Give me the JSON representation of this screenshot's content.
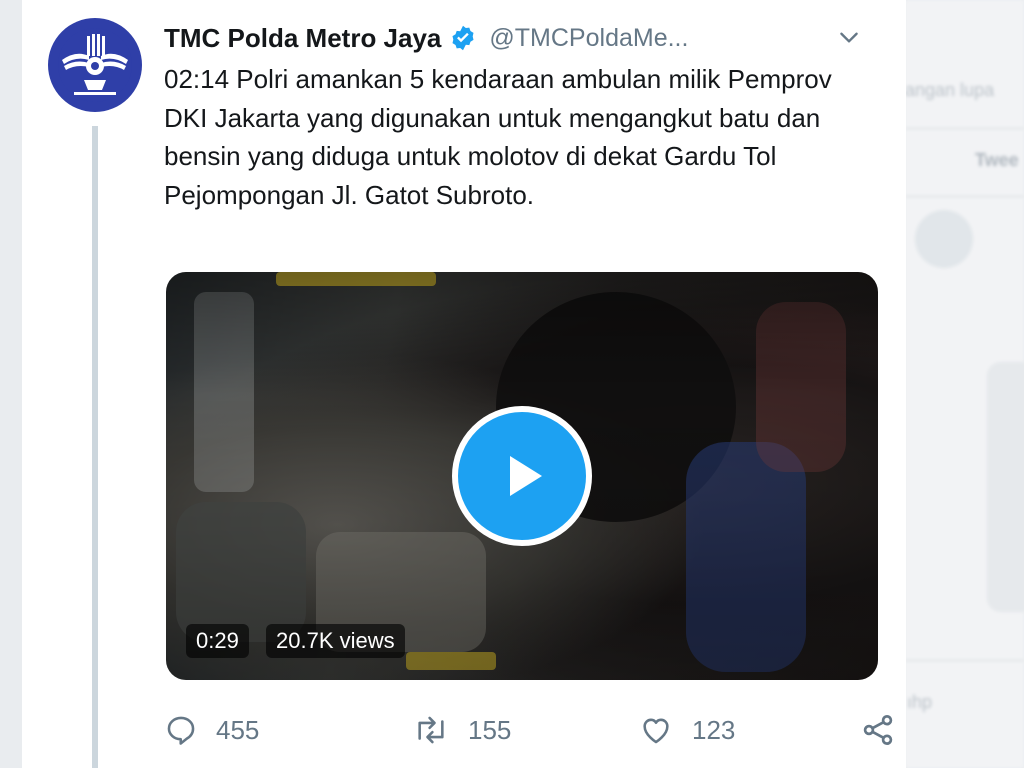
{
  "tweet": {
    "display_name": "TMC Polda Metro Jaya",
    "handle": "@TMCPoldaMe...",
    "verified": true,
    "text": "02:14 Polri amankan 5 kendaraan ambulan milik Pemprov DKI Jakarta yang digunakan untuk mengangkut batu dan bensin yang diduga untuk molotov di dekat Gardu Tol Pejompongan Jl. Gatot Subroto.",
    "video": {
      "duration": "0:29",
      "views": "20.7K views"
    },
    "actions": {
      "replies": "455",
      "retweets": "155",
      "likes": "123"
    }
  },
  "background": {
    "snippet_1": "angan lupa",
    "snippet_2": "Twee",
    "snippet_3": "ıhp"
  },
  "colors": {
    "accent": "#1da1f2",
    "avatar_bg": "#2f3fa8",
    "muted_text": "#657786"
  },
  "icons": [
    "verified-badge-icon",
    "chevron-down-icon",
    "play-icon",
    "reply-icon",
    "retweet-icon",
    "like-icon",
    "share-icon"
  ]
}
